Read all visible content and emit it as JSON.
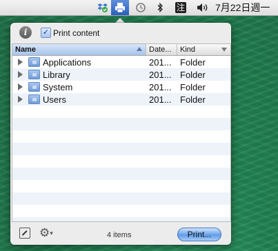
{
  "menubar": {
    "icons": [
      "dropbox-icon",
      "printer-icon",
      "time-machine-icon",
      "bluetooth-icon",
      "input-method-icon",
      "volume-icon"
    ],
    "input_method_glyph": "注",
    "clock": "7月22日週一"
  },
  "popover": {
    "print_content_label": "Print content",
    "print_content_checked": true,
    "columns": {
      "name": "Name",
      "date": "Date...",
      "kind": "Kind"
    },
    "rows": [
      {
        "name": "Applications",
        "date": "201...",
        "kind": "Folder"
      },
      {
        "name": "Library",
        "date": "201...",
        "kind": "Folder"
      },
      {
        "name": "System",
        "date": "201...",
        "kind": "Folder"
      },
      {
        "name": "Users",
        "date": "201...",
        "kind": "Folder"
      }
    ],
    "status": "4 items",
    "print_button": "Print..."
  }
}
